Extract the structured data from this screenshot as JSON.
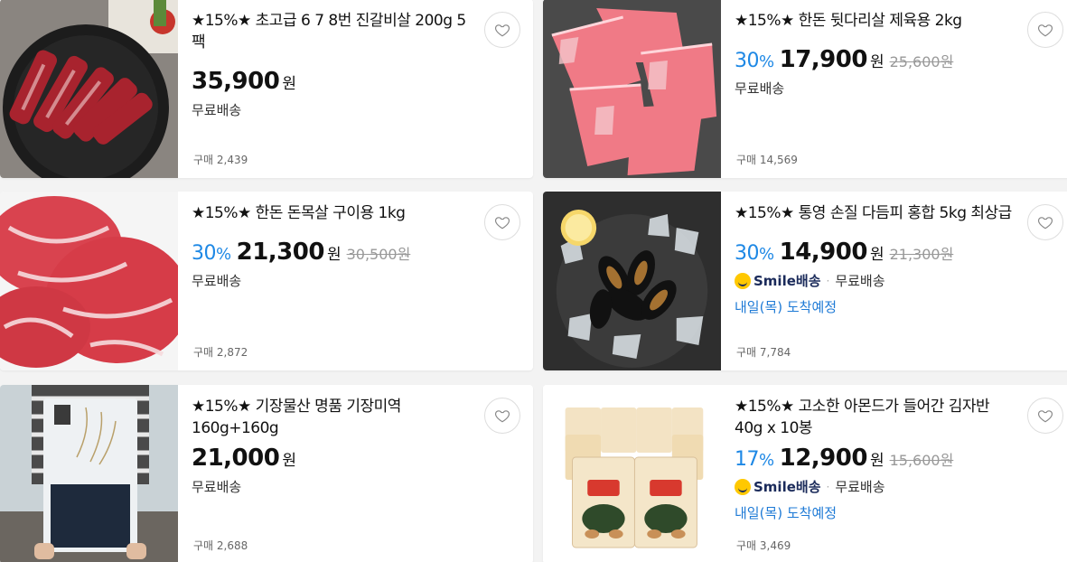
{
  "products": [
    {
      "title": "★15%★ 초고급 6 7 8번 진갈비살 200g 5팩",
      "discount": "",
      "price": "35,900",
      "currency": "원",
      "original_price": "",
      "shipping": "무료배송",
      "smile_label": "",
      "arrival": "",
      "sold": "구매 2,439"
    },
    {
      "title": "★15%★ 한돈 뒷다리살 제육용 2kg",
      "discount": "30",
      "price": "17,900",
      "currency": "원",
      "original_price": "25,600원",
      "shipping": "무료배송",
      "smile_label": "",
      "arrival": "",
      "sold": "구매 14,569"
    },
    {
      "title": "★15%★ 한돈 돈목살 구이용 1kg",
      "discount": "30",
      "price": "21,300",
      "currency": "원",
      "original_price": "30,500원",
      "shipping": "무료배송",
      "smile_label": "",
      "arrival": "",
      "sold": "구매 2,872"
    },
    {
      "title": "★15%★ 통영 손질 다듬피 홍합 5kg 최상급",
      "discount": "30",
      "price": "14,900",
      "currency": "원",
      "original_price": "21,300원",
      "shipping": "무료배송",
      "smile_label": "Smile배송",
      "arrival": "내일(목) 도착예정",
      "sold": "구매 7,784"
    },
    {
      "title": "★15%★ 기장물산 명품 기장미역 160g+160g",
      "discount": "",
      "price": "21,000",
      "currency": "원",
      "original_price": "",
      "shipping": "무료배송",
      "smile_label": "",
      "arrival": "",
      "sold": "구매 2,688"
    },
    {
      "title": "★15%★ 고소한 아몬드가 들어간 김자반 40g x 10봉",
      "discount": "17",
      "price": "12,900",
      "currency": "원",
      "original_price": "15,600원",
      "shipping": "무료배송",
      "smile_label": "Smile배송",
      "arrival": "내일(목) 도착예정",
      "sold": "구매 3,469"
    }
  ],
  "percent_sign": "%",
  "smile_dot": "·",
  "colors": {
    "discount": "#1e88e5",
    "arrival": "#1e7ad6",
    "smile_badge": "#ffc800",
    "background": "#f3f3f3"
  },
  "icons": {
    "heart": "heart-outline-icon",
    "smile": "smile-delivery-icon"
  }
}
